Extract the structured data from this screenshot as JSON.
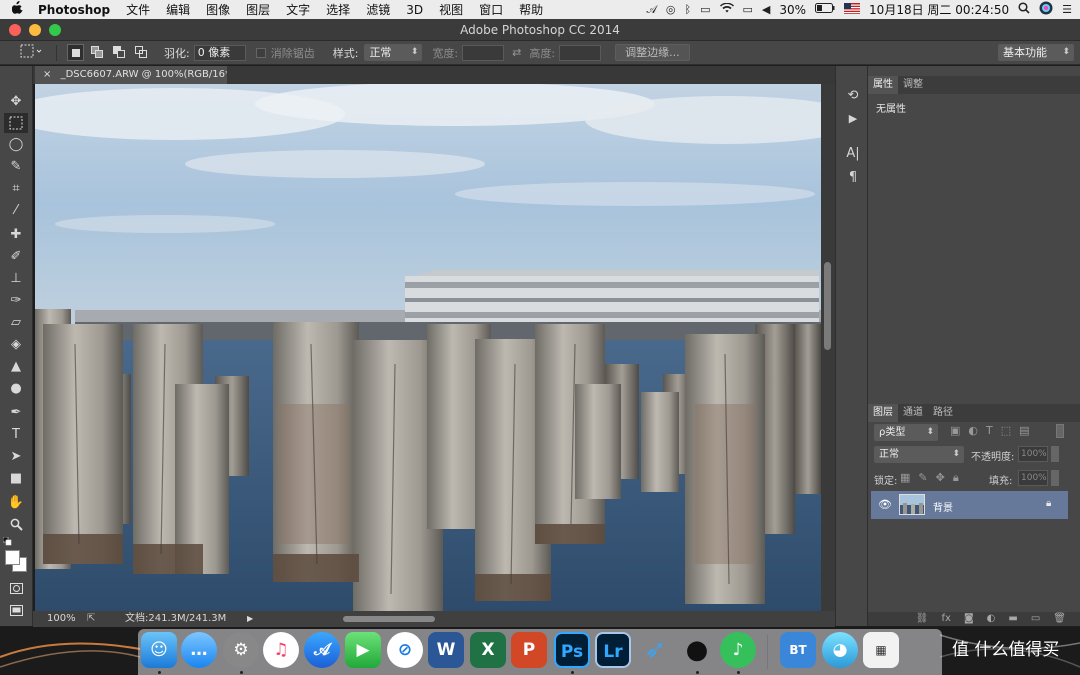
{
  "menubar": {
    "apple": "",
    "app_name": "Photoshop",
    "items": [
      "文件",
      "编辑",
      "图像",
      "图层",
      "文字",
      "选择",
      "滤镜",
      "3D",
      "视图",
      "窗口",
      "帮助"
    ],
    "battery": "30%",
    "datetime": "10月18日 周二  00:24:50"
  },
  "window": {
    "title": "Adobe Photoshop CC 2014"
  },
  "options": {
    "feather_label": "羽化:",
    "feather_value": "0 像素",
    "antialias_label": "消除锯齿",
    "style_label": "样式:",
    "style_value": "正常",
    "width_label": "宽度:",
    "height_label": "高度:",
    "refine_edge": "调整边缘...",
    "workspace": "基本功能"
  },
  "document": {
    "close": "×",
    "tab_title": "_DSC6607.ARW @ 100%(RGB/16*)",
    "zoom": "100%",
    "doc_size": "文档:241.3M/241.3M"
  },
  "properties": {
    "tabs": [
      "属性",
      "调整"
    ],
    "content": "无属性"
  },
  "layers": {
    "tabs": [
      "图层",
      "通道",
      "路径"
    ],
    "filter_label": "ρ类型",
    "blend_mode": "正常",
    "opacity_label": "不透明度:",
    "opacity_value": "100%",
    "lock_label": "锁定:",
    "fill_label": "填充:",
    "fill_value": "100%",
    "layer_name": "背景"
  },
  "dock": {
    "apps": [
      "Finder",
      "信息",
      "系统偏好设置",
      "iTunes",
      "Instruments",
      "FaceTime",
      "Safari",
      "Word",
      "Excel",
      "PowerPoint",
      "Photoshop",
      "Lightroom",
      "迅雷",
      "QQ",
      "QQ音乐",
      "BT",
      "Tweetbot",
      "计算器"
    ],
    "ps_label": "Ps",
    "lr_label": "Lr",
    "word_label": "W",
    "excel_label": "X",
    "ppt_label": "P"
  },
  "watermark": "值 什么值得买",
  "colors": {
    "accent": "#66799a",
    "panel": "#474747",
    "ps_blue": "#31a8ff"
  }
}
